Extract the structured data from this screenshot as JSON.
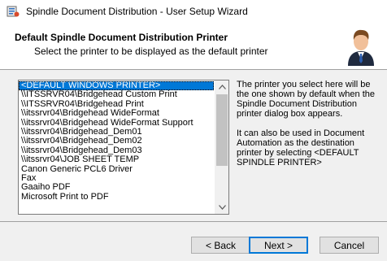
{
  "window": {
    "title": "Spindle Document Distribution - User Setup Wizard"
  },
  "header": {
    "title": "Default Spindle Document Distribution Printer",
    "subtitle": "Select the printer to be displayed as the default printer"
  },
  "printer_list": {
    "items": [
      "<DEFAULT WINDOWS PRINTER>",
      "\\\\ITSSRVR04\\Bridgehead Custom Print",
      "\\\\ITSSRVR04\\Bridgehead Print",
      "\\\\itssrvr04\\Bridgehead WideFormat",
      "\\\\itssrvr04\\Bridgehead WideFormat Support",
      "\\\\itssrvr04\\Bridgehead_Dem01",
      "\\\\itssrvr04\\Bridgehead_Dem02",
      "\\\\itssrvr04\\Bridgehead_Dem03",
      "\\\\itssrvr04\\JOB SHEET TEMP",
      "Canon Generic PCL6 Driver",
      "Fax",
      "Gaaiho PDF",
      "Microsoft Print to PDF"
    ],
    "selected_index": 0
  },
  "description": {
    "para1": "The printer you select here will be the one shown by default when the Spindle Document Distribution printer dialog box appears.",
    "para2": "It can also be used in Document Automation as the destination printer by selecting <DEFAULT SPINDLE PRINTER>"
  },
  "buttons": {
    "back": "< Back",
    "next": "Next >",
    "cancel": "Cancel"
  },
  "icons": {
    "app": "spindle-app-icon",
    "header": "user-icon"
  },
  "colors": {
    "selection": "#0078d7",
    "accent_border": "#0078d7"
  }
}
